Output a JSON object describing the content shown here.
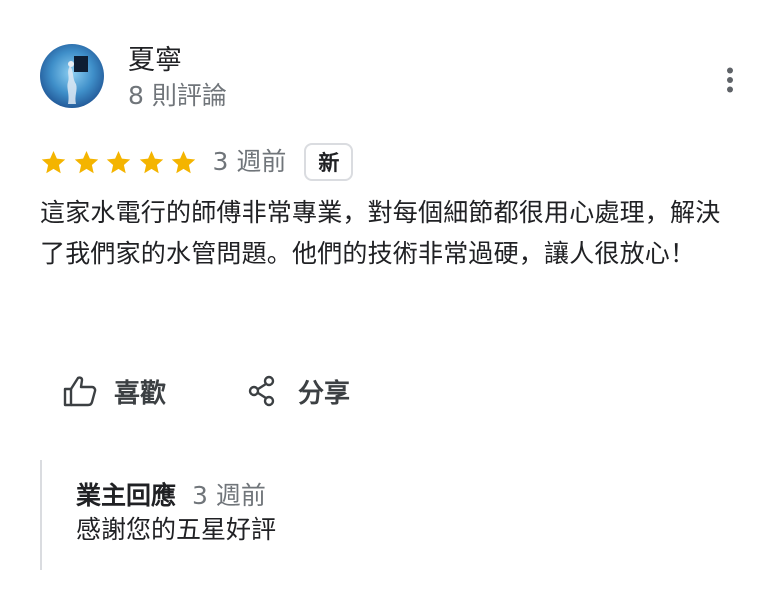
{
  "reviewer": {
    "name": "夏寧",
    "review_count": "8 則評論"
  },
  "review": {
    "rating": 5,
    "max_rating": 5,
    "date": "3 週前",
    "badge": "新",
    "text": "這家水電行的師傅非常專業，對每個細節都很用心處理，解決了我們家的水管問題。他們的技術非常過硬，讓人很放心！"
  },
  "actions": {
    "like_label": "喜歡",
    "share_label": "分享"
  },
  "owner_reply": {
    "author": "業主回應",
    "date": "3 週前",
    "text": "感謝您的五星好評"
  },
  "icons": {
    "avatar": "profile-photo",
    "more": "more-vert-icon",
    "star": "star-icon",
    "like": "thumb-up-icon",
    "share": "share-icon"
  },
  "colors": {
    "star": "#f4b400",
    "text_primary": "#202124",
    "text_secondary": "#70757a",
    "border": "#dadce0"
  }
}
